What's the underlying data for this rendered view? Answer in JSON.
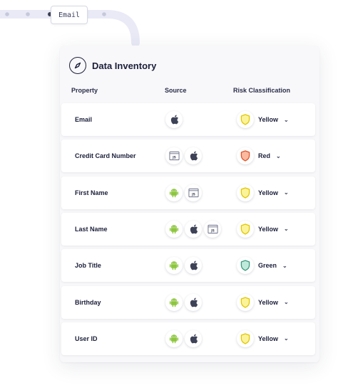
{
  "flow": {
    "chip_label": "Email"
  },
  "panel": {
    "title": "Data Inventory",
    "columns": {
      "property": "Property",
      "source": "Source",
      "risk": "Risk Classification"
    },
    "rows": [
      {
        "property": "Email",
        "sources": [
          "apple"
        ],
        "risk": "Yellow"
      },
      {
        "property": "Credit Card Number",
        "sources": [
          "js",
          "apple"
        ],
        "risk": "Red"
      },
      {
        "property": "First Name",
        "sources": [
          "android",
          "js"
        ],
        "risk": "Yellow"
      },
      {
        "property": "Last Name",
        "sources": [
          "android",
          "apple",
          "js"
        ],
        "risk": "Yellow"
      },
      {
        "property": "Job Title",
        "sources": [
          "android",
          "apple"
        ],
        "risk": "Green"
      },
      {
        "property": "Birthday",
        "sources": [
          "android",
          "apple"
        ],
        "risk": "Yellow"
      },
      {
        "property": "User ID",
        "sources": [
          "android",
          "apple"
        ],
        "risk": "Yellow"
      }
    ]
  },
  "icons": {
    "apple": "apple-icon",
    "android": "android-icon",
    "js": "javascript-icon",
    "compass": "compass-icon",
    "shield": "shield-icon",
    "chevron": "chevron-down-icon"
  },
  "colors": {
    "Yellow": {
      "stroke": "#e2c600",
      "fill": "#fbf39a"
    },
    "Red": {
      "stroke": "#e0542c",
      "fill": "#fbb99f"
    },
    "Green": {
      "stroke": "#3c9a7e",
      "fill": "#bfeadb"
    },
    "android": "#8dc63f",
    "apple": "#3d4257",
    "flow_line": "#e6e7f4"
  }
}
